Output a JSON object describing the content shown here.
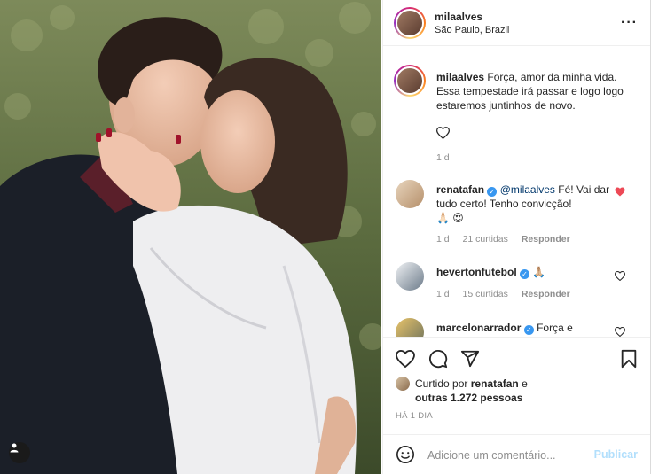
{
  "post": {
    "username": "milaalves",
    "location": "São Paulo, Brazil",
    "more_icon": "ellipsis-icon"
  },
  "caption": {
    "username": "milaalves",
    "text": "Força, amor da minha vida. Essa tempestade irá passar e logo logo estaremos juntinhos de novo.",
    "time": "1 d"
  },
  "comments": [
    {
      "username": "renatafan",
      "verified": true,
      "mention": "@milaalves",
      "text": "Fé! Vai dar tudo certo! Tenho convicção!",
      "emoji": "🙏🏻 😍",
      "time": "1 d",
      "likes": "21 curtidas",
      "reply": "Responder",
      "liked": true
    },
    {
      "username": "hevertonfutebol",
      "verified": true,
      "text": "🙏🏼",
      "time": "1 d",
      "likes": "15 curtidas",
      "reply": "Responder",
      "liked": false
    },
    {
      "username": "marcelonarrador",
      "verified": true,
      "text": "Força e",
      "liked": false
    }
  ],
  "likes": {
    "prefix": "Curtido por",
    "user": "renatafan",
    "middle": "e",
    "others": "outras 1.272 pessoas"
  },
  "timestamp": "HÁ 1 DIA",
  "comment_input": {
    "placeholder": "Adicione um comentário...",
    "publish_label": "Publicar"
  },
  "colors": {
    "like_red": "#ed4956",
    "verified_blue": "#3897f0",
    "publish_disabled": "#b2dffc"
  }
}
